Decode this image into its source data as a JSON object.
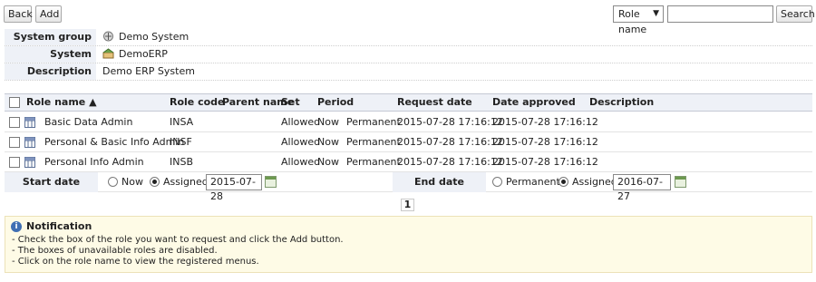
{
  "toolbar": {
    "back_label": "Back",
    "add_label": "Add",
    "search_field": "Role name",
    "search_value": "",
    "search_label": "Search"
  },
  "info": {
    "system_group_label": "System group",
    "system_group_value": "Demo System",
    "system_label": "System",
    "system_value": "DemoERP",
    "description_label": "Description",
    "description_value": "Demo ERP System"
  },
  "grid": {
    "headers": {
      "role_name": "Role name ▲",
      "role_code": "Role code",
      "parent_name": "Parent name",
      "set": "Set",
      "period": "Period",
      "request_date": "Request date",
      "date_approved": "Date approved",
      "description": "Description"
    },
    "rows": [
      {
        "role_name": "Basic Data Admin",
        "role_code": "INSA",
        "parent_name": "",
        "set": "Allowed",
        "period_start": "Now",
        "period_end": "Permanent",
        "request_date": "2015-07-28 17:16:12",
        "date_approved": "2015-07-28 17:16:12",
        "description": ""
      },
      {
        "role_name": "Personal & Basic Info Admin",
        "role_code": "INSF",
        "parent_name": "",
        "set": "Allowed",
        "period_start": "Now",
        "period_end": "Permanent",
        "request_date": "2015-07-28 17:16:12",
        "date_approved": "2015-07-28 17:16:12",
        "description": ""
      },
      {
        "role_name": "Personal Info Admin",
        "role_code": "INSB",
        "parent_name": "",
        "set": "Allowed",
        "period_start": "Now",
        "period_end": "Permanent",
        "request_date": "2015-07-28 17:16:12",
        "date_approved": "2015-07-28 17:16:12",
        "description": ""
      }
    ]
  },
  "dates": {
    "start_label": "Start date",
    "start_now": "Now",
    "start_assigned": "Assigned",
    "start_value": "2015-07-28",
    "start_selected": "Assigned",
    "end_label": "End date",
    "end_permanent": "Permanent",
    "end_assigned": "Assigned",
    "end_value": "2016-07-27",
    "end_selected": "Assigned"
  },
  "pagination": {
    "current_page": "1"
  },
  "notification": {
    "title": "Notification",
    "lines": [
      "- Check the box of the role you want to request and click the Add button.",
      "- The boxes of unavailable roles are disabled.",
      "- Click on the role name to view the registered menus."
    ]
  }
}
